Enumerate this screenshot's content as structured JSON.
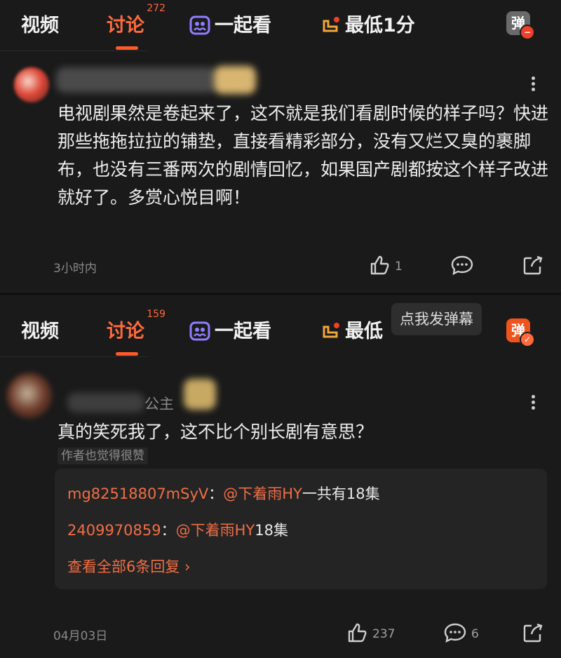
{
  "tabs_1": {
    "video": "视频",
    "discuss": "讨论",
    "discuss_count": "272",
    "watch_together": "一起看",
    "lowest": "最低1分",
    "danmu": "弹"
  },
  "comment_1": {
    "text": "电视剧果然是卷起来了，这不就是我们看剧时候的样子吗？快进那些拖拖拉拉的铺垫，直接看精彩部分，没有又烂又臭的裹脚布，也没有三番两次的剧情回忆，如果国产剧都按这个样子改进就好了。多赏心悦目啊！",
    "time": "3小时内",
    "likes": "1"
  },
  "tabs_2": {
    "video": "视频",
    "discuss": "讨论",
    "discuss_count": "159",
    "watch_together": "一起看",
    "lowest": "最低",
    "danmu": "弹",
    "tooltip": "点我发弹幕"
  },
  "comment_2": {
    "username_partial": "公主",
    "text": "真的笑死我了，这不比个别长剧有意思？",
    "author_badge": "作者也觉得很赞",
    "replies": [
      {
        "user": "mg82518807mSyV",
        "sep": "：",
        "mention": "@下着雨HY",
        "content": "一共有18集"
      },
      {
        "user": "2409970859",
        "sep": "：",
        "mention": "@下着雨HY",
        "content": "18集"
      }
    ],
    "view_all": "查看全部6条回复 ›",
    "date": "04月03日",
    "likes": "237",
    "comments": "6"
  },
  "colors": {
    "accent": "#ff6a3c",
    "background": "#1a1a1a",
    "reply_box": "#242424"
  }
}
